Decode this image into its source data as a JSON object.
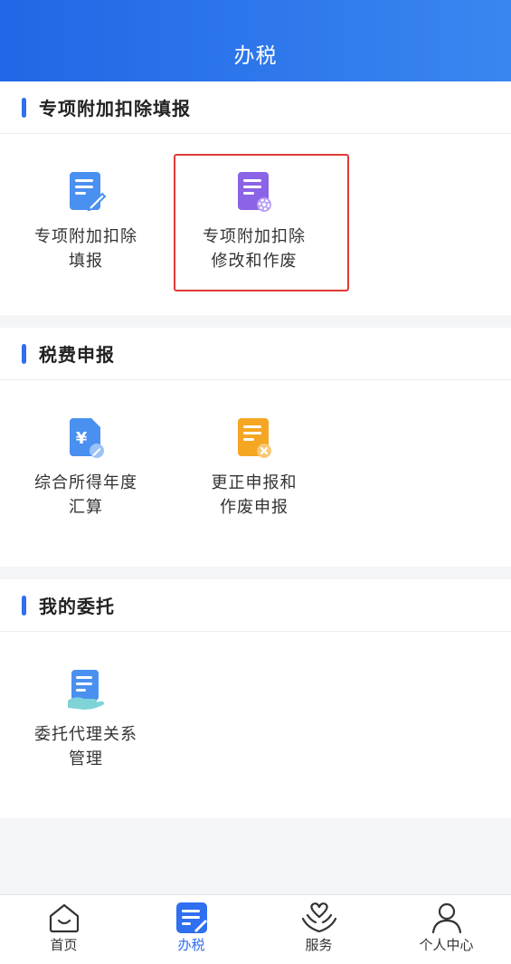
{
  "header": {
    "title": "办税"
  },
  "sections": [
    {
      "title": "专项附加扣除填报",
      "items": [
        {
          "line1": "专项附加扣除",
          "line2": "填报",
          "icon": "document-pen-icon"
        },
        {
          "line1": "专项附加扣除",
          "line2": "修改和作废",
          "icon": "document-gear-icon"
        }
      ]
    },
    {
      "title": "税费申报",
      "items": [
        {
          "line1": "综合所得年度",
          "line2": "汇算",
          "icon": "yuan-document-icon"
        },
        {
          "line1": "更正申报和",
          "line2": "作废申报",
          "icon": "document-cancel-icon"
        }
      ]
    },
    {
      "title": "我的委托",
      "items": [
        {
          "line1": "委托代理关系",
          "line2": "管理",
          "icon": "document-hand-icon"
        }
      ]
    }
  ],
  "tabbar": {
    "items": [
      {
        "label": "首页",
        "icon": "home-icon"
      },
      {
        "label": "办税",
        "icon": "tax-document-icon",
        "active": true
      },
      {
        "label": "服务",
        "icon": "heart-hand-icon"
      },
      {
        "label": "个人中心",
        "icon": "person-icon"
      }
    ]
  },
  "colors": {
    "accent": "#2f6ff0",
    "highlight_border": "#e03a36",
    "header_gradient_start": "#2067e6",
    "header_gradient_end": "#3a86f0"
  }
}
